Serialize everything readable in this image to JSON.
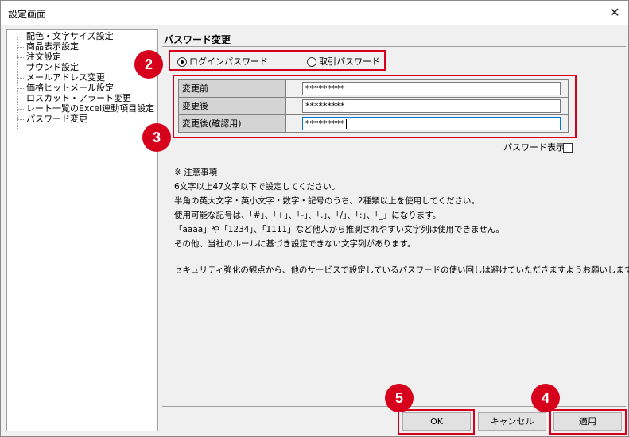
{
  "window": {
    "title": "設定画面",
    "close_glyph": "✕"
  },
  "tree": {
    "items": [
      {
        "label": "配色・文字サイズ設定"
      },
      {
        "label": "商品表示設定"
      },
      {
        "label": "注文設定"
      },
      {
        "label": "サウンド設定"
      },
      {
        "label": "メールアドレス変更"
      },
      {
        "label": "価格ヒットメール設定"
      },
      {
        "label": "ロスカット・アラート変更"
      },
      {
        "label": "レート一覧のExcel連動項目設定"
      },
      {
        "label": "パスワード変更"
      }
    ]
  },
  "panel": {
    "title": "パスワード変更",
    "radios": {
      "login": {
        "label": "ログインパスワード",
        "checked": true
      },
      "trade": {
        "label": "取引パスワード",
        "checked": false
      }
    },
    "form": {
      "rows": [
        {
          "label": "変更前",
          "value": "*********"
        },
        {
          "label": "変更後",
          "value": "*********"
        },
        {
          "label": "変更後(確認用)",
          "value": "*********"
        }
      ]
    },
    "show_password_label": "パスワード表示",
    "notes": [
      "※ 注意事項",
      "6文字以上47文字以下で設定してください。",
      "半角の英大文字・英小文字・数字・記号のうち、2種類以上を使用してください。",
      "使用可能な記号は、「#」、「+」、「-」、「.」、「/」、「:」、「_」になります。",
      "「aaaa」や「1234」、「1111」など他人から推測されやすい文字列は使用できません。",
      "その他、当社のルールに基づき設定できない文字列があります。",
      "セキュリティ強化の観点から、他のサービスで設定しているパスワードの使い回しは避けていただきますようお願いします。"
    ]
  },
  "buttons": {
    "ok": "OK",
    "cancel": "キャンセル",
    "apply": "適用"
  },
  "badges": {
    "b2": "2",
    "b3": "3",
    "b4": "4",
    "b5": "5"
  },
  "colors": {
    "highlight": "#d6001c",
    "label_bg": "#d4d4d4",
    "focus": "#0078d7"
  }
}
